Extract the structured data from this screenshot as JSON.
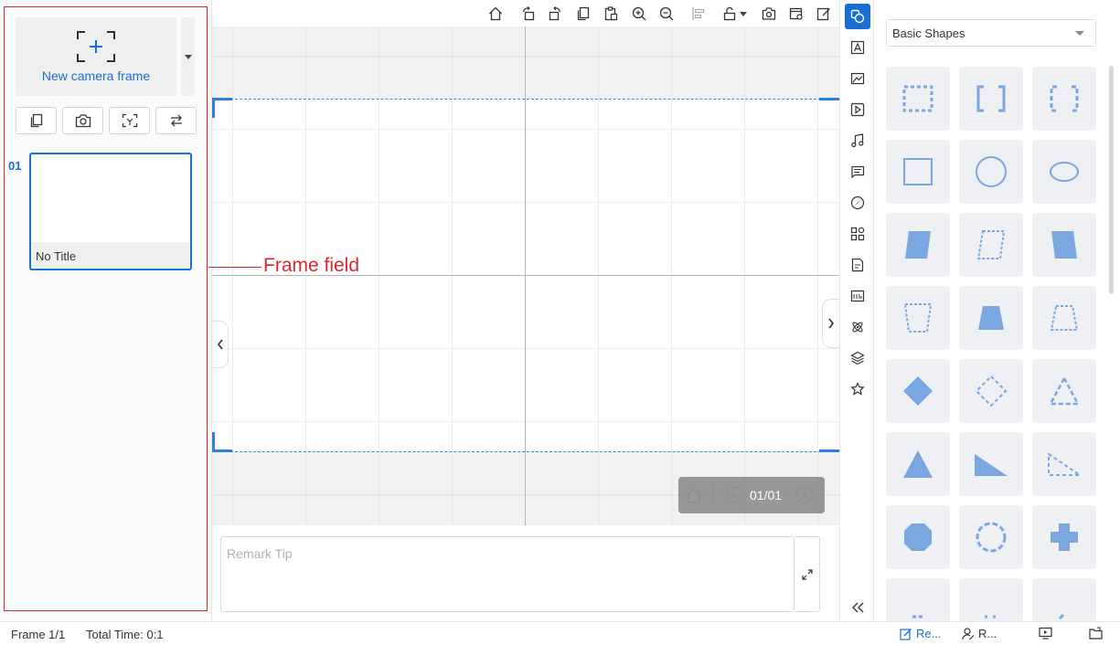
{
  "left_panel": {
    "new_frame_label": "New camera frame",
    "frames": [
      {
        "number": "01",
        "title": "No Title"
      }
    ]
  },
  "canvas": {
    "pager": {
      "count": "01/01"
    }
  },
  "remark": {
    "placeholder": "Remark Tip"
  },
  "shapes_panel": {
    "category": "Basic Shapes",
    "accent_color": "#7ba7e0"
  },
  "status_bar": {
    "frame_count": "Frame 1/1",
    "total_time": "Total Time: 0:1",
    "btn_record": "Re...",
    "btn_role": "R..."
  },
  "annotation": {
    "label": "Frame field"
  },
  "colors": {
    "accent": "#1a6fd6",
    "annotation": "#e0242b"
  }
}
